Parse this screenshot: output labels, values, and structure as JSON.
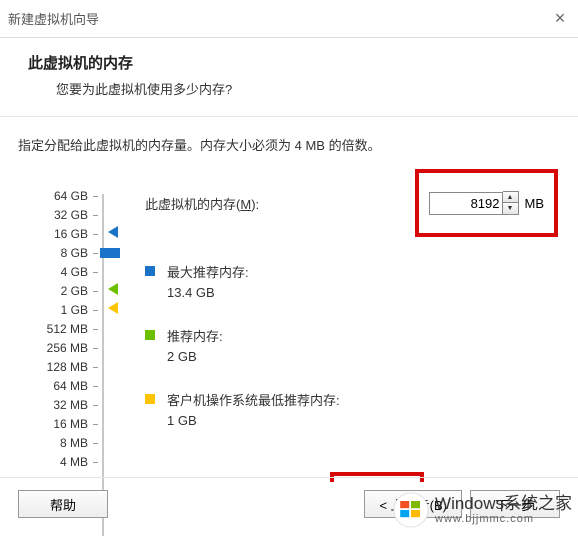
{
  "window": {
    "title": "新建虚拟机向导"
  },
  "header": {
    "title": "此虚拟机的内存",
    "subtitle": "您要为此虚拟机使用多少内存?"
  },
  "description": "指定分配给此虚拟机的内存量。内存大小必须为 4 MB 的倍数。",
  "memory": {
    "label_prefix": "此虚拟机的内存(",
    "label_accel": "M",
    "label_suffix": "):",
    "value": "8192",
    "unit": "MB"
  },
  "ticks": [
    "64 GB",
    "32 GB",
    "16 GB",
    "8 GB",
    "4 GB",
    "2 GB",
    "1 GB",
    "512 MB",
    "256 MB",
    "128 MB",
    "64 MB",
    "32 MB",
    "16 MB",
    "8 MB",
    "4 MB"
  ],
  "legend": {
    "max": {
      "label": "最大推荐内存:",
      "value": "13.4 GB"
    },
    "rec": {
      "label": "推荐内存:",
      "value": "2 GB"
    },
    "min": {
      "label": "客户机操作系统最低推荐内存:",
      "value": "1 GB"
    }
  },
  "buttons": {
    "help": "帮助",
    "back": "< 上一步(B)",
    "next": "下一步"
  },
  "watermark": {
    "brand_en": "Windows",
    "brand_cn": "系统之家",
    "url": "www.bjjmmc.com"
  }
}
